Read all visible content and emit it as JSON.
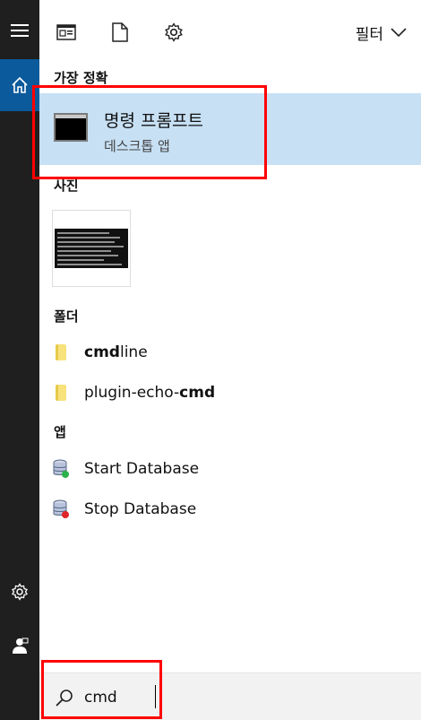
{
  "rail": {
    "menu_icon": "hamburger-icon",
    "home_icon": "home-icon",
    "settings_icon": "gear-icon",
    "account_icon": "account-icon"
  },
  "toolbar": {
    "documents_icon": "document-view-icon",
    "file_icon": "file-icon",
    "settings_icon": "gear-icon",
    "filter_label": "필터",
    "filter_icon": "chevron-down-icon"
  },
  "best_match": {
    "header": "가장 정확",
    "title": "명령 프롬프트",
    "subtitle": "데스크톱 앱"
  },
  "photos": {
    "header": "사진"
  },
  "folders": {
    "header": "폴더",
    "items": [
      {
        "prefix": "",
        "bold": "cmd",
        "suffix": "line"
      },
      {
        "prefix": "plugin-echo-",
        "bold": "cmd",
        "suffix": ""
      }
    ]
  },
  "apps": {
    "header": "앱",
    "items": [
      {
        "label": "Start Database",
        "badge_color": "#2bb24c"
      },
      {
        "label": "Stop Database",
        "badge_color": "#e0242b"
      }
    ]
  },
  "search": {
    "value": "cmd",
    "icon": "search-icon"
  },
  "colors": {
    "accent": "#0b5a9b",
    "selection": "#c7e0f4",
    "annotation": "#ff0000"
  }
}
